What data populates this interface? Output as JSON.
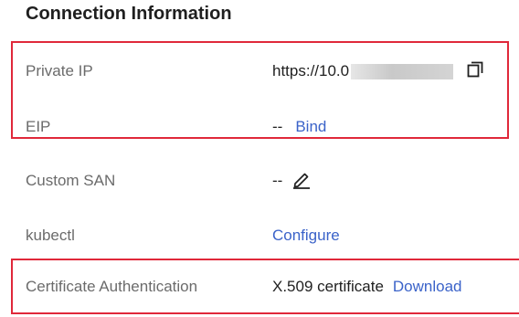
{
  "section": {
    "title": "Connection Information"
  },
  "rows": {
    "private_ip": {
      "label": "Private IP",
      "value": "https://10.0"
    },
    "eip": {
      "label": "EIP",
      "value": "--",
      "action": "Bind"
    },
    "custom_san": {
      "label": "Custom SAN",
      "value": "--"
    },
    "kubectl": {
      "label": "kubectl",
      "action": "Configure"
    },
    "cert_auth": {
      "label": "Certificate Authentication",
      "value": "X.509 certificate",
      "action": "Download"
    }
  },
  "colors": {
    "highlight": "#e0283a",
    "link": "#3b63c9",
    "label": "#6b6b6b",
    "text": "#1f1f1f"
  },
  "icons": {
    "copy": "copy-icon",
    "edit": "pencil-edit-icon"
  }
}
